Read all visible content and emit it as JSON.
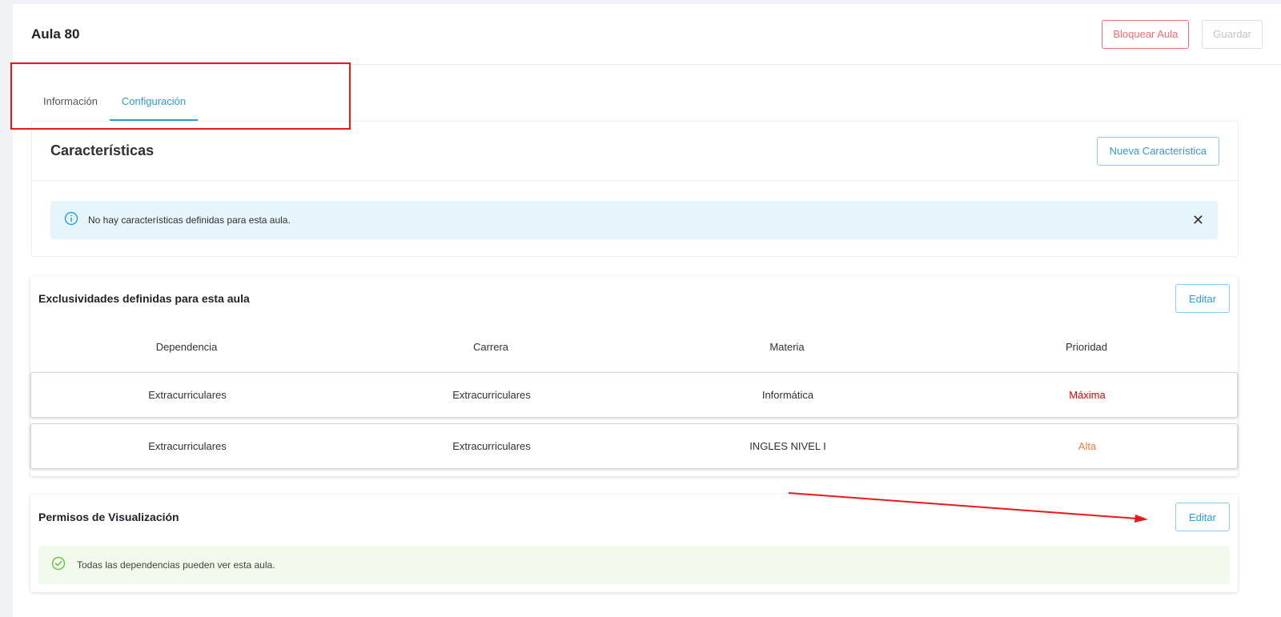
{
  "header": {
    "title": "Aula 80",
    "block_label": "Bloquear Aula",
    "save_label": "Guardar"
  },
  "tabs": [
    {
      "label": "Información",
      "active": false
    },
    {
      "label": "Configuración",
      "active": true
    }
  ],
  "caracteristicas": {
    "title": "Características",
    "new_button": "Nueva Característica",
    "alert_text": "No hay características definidas para esta aula.",
    "close_glyph": "✕"
  },
  "exclusividades": {
    "title": "Exclusividades definidas para esta aula",
    "edit_label": "Editar",
    "columns": [
      "Dependencia",
      "Carrera",
      "Materia",
      "Prioridad"
    ],
    "rows": [
      {
        "dependencia": "Extracurriculares",
        "carrera": "Extracurriculares",
        "materia": "Informática",
        "prioridad": "Máxima",
        "prioridad_color": "#e60000"
      },
      {
        "dependencia": "Extracurriculares",
        "carrera": "Extracurriculares",
        "materia": "INGLES NIVEL I",
        "prioridad": "Alta",
        "prioridad_color": "#f07c3c"
      }
    ]
  },
  "permisos": {
    "title": "Permisos de Visualización",
    "edit_label": "Editar",
    "alert_text": "Todas las dependencias pueden ver esta aula."
  },
  "colors": {
    "accent": "#2d9cdb",
    "danger": "#f56c6c",
    "annotation": "#e81919",
    "success": "#67c23a"
  },
  "icons": {
    "info": "info-circle-icon",
    "close": "close-icon",
    "success": "check-circle-icon"
  }
}
